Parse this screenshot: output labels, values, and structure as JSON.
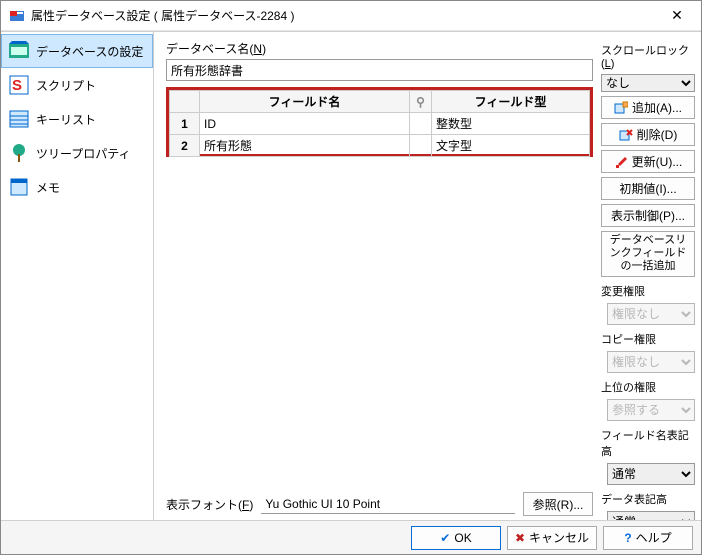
{
  "window": {
    "title": "属性データベース設定 ( 属性データベース-2284 )"
  },
  "sidebar": {
    "items": [
      {
        "label": "データベースの設定",
        "icon": "db-settings-icon",
        "selected": true
      },
      {
        "label": "スクリプト",
        "icon": "script-icon"
      },
      {
        "label": "キーリスト",
        "icon": "keylist-icon"
      },
      {
        "label": "ツリープロパティ",
        "icon": "tree-icon"
      },
      {
        "label": "メモ",
        "icon": "memo-icon"
      }
    ]
  },
  "center": {
    "db_name_label_pre": "データベース名(",
    "db_name_label_u": "N",
    "db_name_label_post": ")",
    "db_name_value": "所有形態辞書",
    "table": {
      "header_fieldname": "フィールド名",
      "header_fieldtype": "フィールド型",
      "rows": [
        {
          "num": "1",
          "name": "ID",
          "type": "整数型"
        },
        {
          "num": "2",
          "name": "所有形態",
          "type": "文字型"
        }
      ]
    },
    "display_font_label_pre": "表示フォント(",
    "display_font_label_u": "F",
    "display_font_label_post": ")",
    "display_font_value": "Yu Gothic UI 10 Point",
    "ref_button": "参照(R)..."
  },
  "right": {
    "scroll_lock_label_pre": "スクロールロック(",
    "scroll_lock_label_u": "L",
    "scroll_lock_label_post": ")",
    "scroll_lock_value": "なし",
    "add_btn": "追加(A)...",
    "delete_btn": "削除(D)",
    "update_btn": "更新(U)...",
    "initial_btn": "初期値(I)...",
    "display_ctrl_btn": "表示制御(P)...",
    "bulk_add_btn": "データベースリンクフィールドの一括追加",
    "change_perm_label": "変更権限",
    "change_perm_value": "権限なし",
    "copy_perm_label": "コピー権限",
    "copy_perm_value": "権限なし",
    "upper_perm_label": "上位の権限",
    "upper_perm_value": "参照する",
    "field_height_label": "フィールド名表記高",
    "field_height_value": "通常",
    "data_height_label": "データ表記高",
    "data_height_value": "通常"
  },
  "buttons": {
    "ok": "OK",
    "cancel": "キャンセル",
    "help": "ヘルプ"
  }
}
